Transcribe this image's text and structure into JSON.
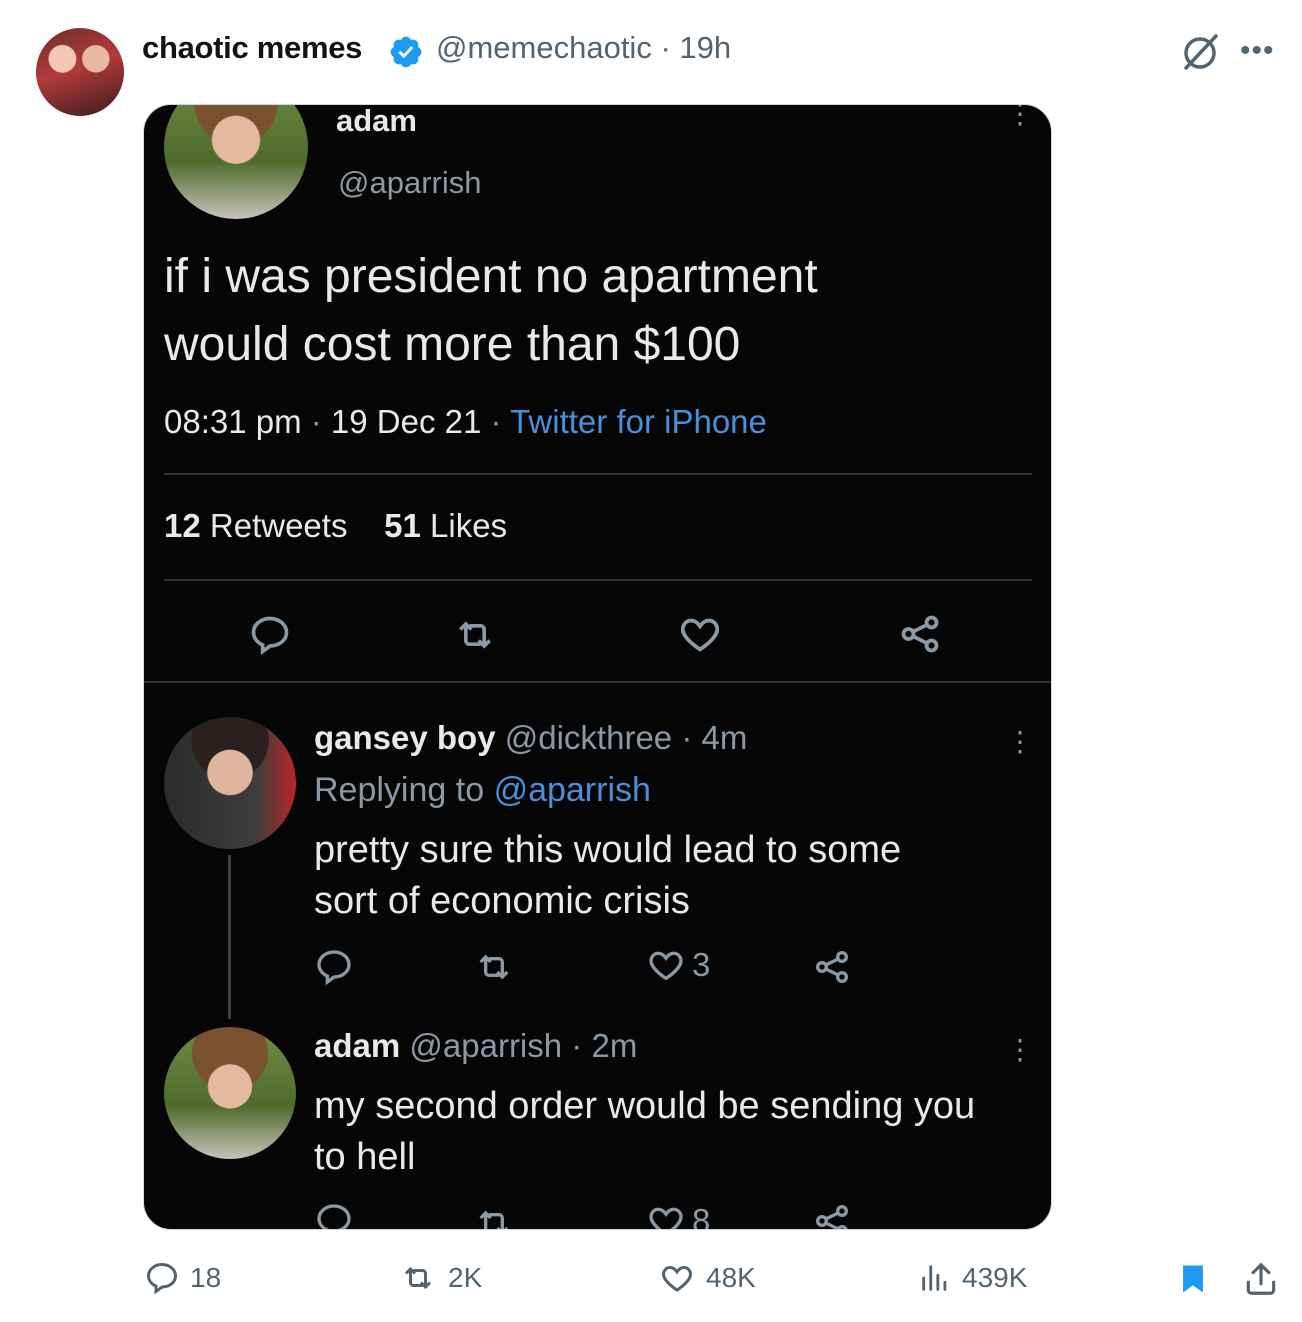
{
  "tweet": {
    "author_name": "chaotic memes",
    "author_handle": "@memechaotic",
    "time": "19h",
    "separator": "·"
  },
  "embedded": {
    "main": {
      "name": "adam",
      "handle": "@aparrish",
      "text_line1": "if i was president no apartment",
      "text_line2": "would cost more than $100",
      "time": "08:31 pm",
      "date": "19 Dec 21",
      "source": "Twitter for iPhone",
      "retweets_count": "12",
      "retweets_label": "Retweets",
      "likes_count": "51",
      "likes_label": "Likes"
    },
    "reply1": {
      "name": "gansey boy",
      "handle": "@dickthree",
      "age": "4m",
      "replying_prefix": "Replying to",
      "replying_to": "@aparrish",
      "text_line1": "pretty sure this would lead to some",
      "text_line2": "sort of economic crisis",
      "likes": "3"
    },
    "reply2": {
      "name": "adam",
      "handle": "@aparrish",
      "age": "2m",
      "text_line1": "my second order would be sending you",
      "text_line2": "to hell",
      "likes": "8"
    }
  },
  "actions": {
    "replies": "18",
    "reposts": "2K",
    "likes": "48K",
    "views": "439K"
  },
  "colors": {
    "verified": "#1d9bf0",
    "bookmark": "#1d9bf0",
    "muted": "#536471"
  },
  "icons": [
    "verified-badge-icon",
    "grok-icon",
    "more-icon",
    "reply-icon",
    "repost-icon",
    "like-icon",
    "share-icon",
    "views-icon",
    "bookmark-icon",
    "upload-icon",
    "kebab-icon"
  ]
}
